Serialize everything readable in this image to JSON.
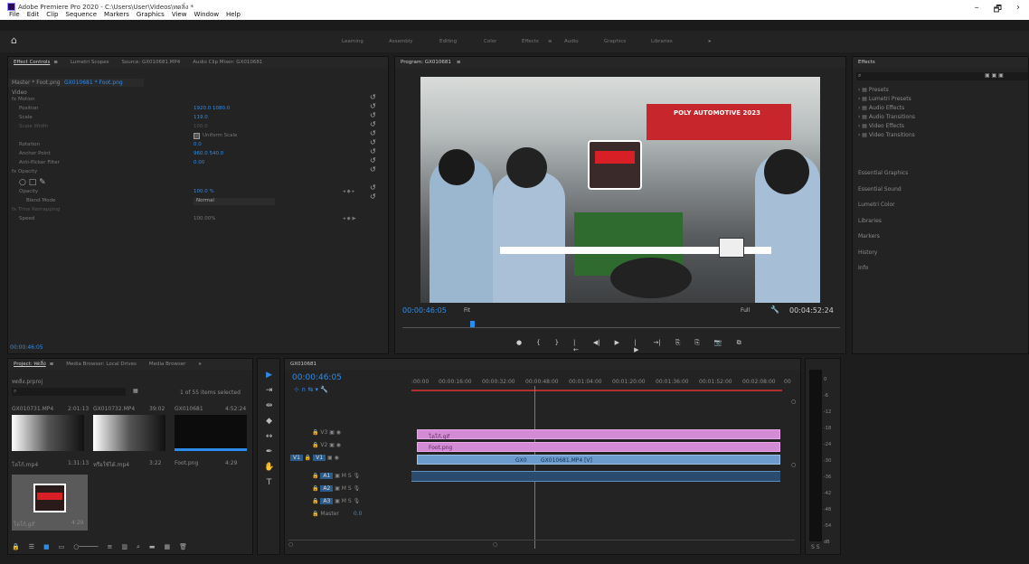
{
  "window": {
    "title": "Adobe Premiere Pro 2020 - C:\\Users\\User\\Videos\\ทดลิ่ง *",
    "menu": [
      "File",
      "Edit",
      "Clip",
      "Sequence",
      "Markers",
      "Graphics",
      "View",
      "Window",
      "Help"
    ],
    "controls": [
      "–",
      "🗗",
      "›"
    ]
  },
  "workspaces": [
    "Learning",
    "Assembly",
    "Editing",
    "Color",
    "Effects",
    "≡",
    "Audio",
    "Graphics",
    "Libraries",
    "»"
  ],
  "effect_controls": {
    "tabs": [
      "Effect Controls",
      "≡",
      "Lumetri Scopes",
      "Source: GX010681.MP4",
      "Audio Clip Mixer: GX010681"
    ],
    "source": "Master * Foot.png",
    "clip": "GX010681 * Foot.png",
    "section": "Video",
    "rows": [
      {
        "label": "fx Motion",
        "value": ""
      },
      {
        "label": "Position",
        "value": "1920.0   1080.0"
      },
      {
        "label": "Scale",
        "value": "119.0"
      },
      {
        "label": "Scale Width",
        "value": "100.0"
      },
      {
        "label": "",
        "value": "Uniform Scale"
      },
      {
        "label": "Rotation",
        "value": "0.0"
      },
      {
        "label": "Anchor Point",
        "value": "960.0   540.0"
      },
      {
        "label": "Anti-flicker Filter",
        "value": "0.00"
      },
      {
        "label": "fx Opacity",
        "value": ""
      },
      {
        "label": "",
        "value": ""
      },
      {
        "label": "Opacity",
        "value": "100.0 %"
      },
      {
        "label": "Blend Mode",
        "value": "Normal"
      },
      {
        "label": "fx Time Remapping",
        "value": ""
      },
      {
        "label": "Speed",
        "value": "100.00%"
      }
    ],
    "timecode": "00:00:46:05"
  },
  "program": {
    "title": "Program: GX010681",
    "timecode": "00:00:46:05",
    "fit": "Fit",
    "quality": "Full",
    "duration": "00:04:52:24",
    "banner": "POLY AUTOMOTIVE 2023",
    "transport": [
      "●",
      "{",
      "}",
      "|←",
      "◀|",
      "▶",
      "|▶",
      "→|",
      "⎘",
      "⎘",
      "📷",
      "⧉",
      "+"
    ]
  },
  "effects_panel": {
    "title": "Effects",
    "items": [
      "Presets",
      "Lumetri Presets",
      "Audio Effects",
      "Audio Transitions",
      "Video Effects",
      "Video Transitions"
    ],
    "sections": [
      "Essential Graphics",
      "Essential Sound",
      "Lumetri Color",
      "Libraries",
      "Markers",
      "History",
      "Info"
    ]
  },
  "project": {
    "tabs": [
      "Project: ทดลิ่ง",
      "≡",
      "Media Browser: Local Drives",
      "Media Browser",
      "»"
    ],
    "file": "ทดลิ่ง.prproj",
    "count": "1 of 55 items selected",
    "items": [
      {
        "name": "GX010731.MP4",
        "dur": "2:01:13"
      },
      {
        "name": "GX010732.MP4",
        "dur": "39:02"
      },
      {
        "name": "GX010681",
        "dur": "4:52:24"
      },
      {
        "name": "โลโก้.mp4",
        "dur": "1:31:13"
      },
      {
        "name": "หรือใช้ได้.mp4",
        "dur": "3:22"
      },
      {
        "name": "Foot.png",
        "dur": "4:29"
      },
      {
        "name": "โลโก้.gif",
        "dur": "4:29"
      }
    ]
  },
  "timeline": {
    "name": "GX010681",
    "timecode": "00:00:46:05",
    "ruler": [
      ":00:00",
      "00:00:16:00",
      "00:00:32:00",
      "00:00:48:00",
      "00:01:04:00",
      "00:01:20:00",
      "00:01:36:00",
      "00:01:52:00",
      "00:02:08:00",
      "00"
    ],
    "video_tracks": [
      "V3",
      "V2",
      "V1"
    ],
    "audio_tracks": [
      "A1",
      "A2",
      "A3"
    ],
    "master": "Master",
    "master_val": "0.0",
    "clips": {
      "v3": "โลโก้.gif",
      "v2": "Foot.png",
      "v1": "GX010681.MP4 [V]",
      "v1short": "GX0"
    }
  },
  "meter": {
    "scale": [
      "0",
      "-6",
      "-12",
      "-18",
      "-24",
      "-30",
      "-36",
      "-42",
      "-48",
      "-54",
      "dB"
    ],
    "solo": "S S"
  }
}
